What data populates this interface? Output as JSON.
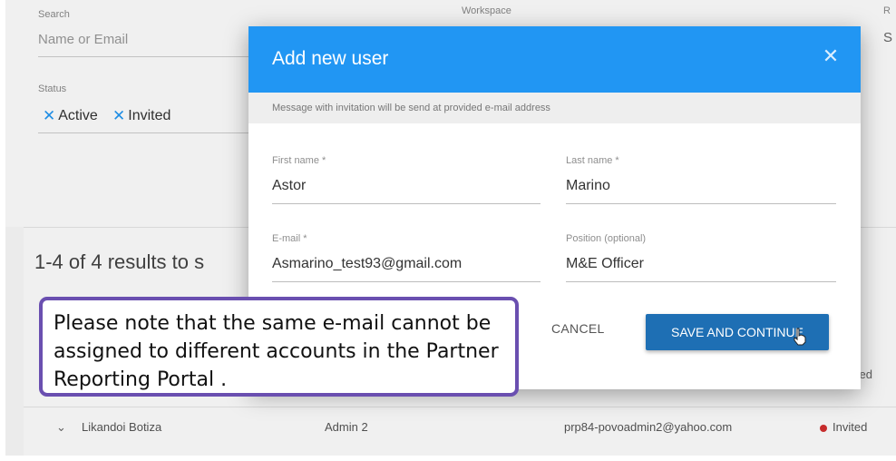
{
  "filters": {
    "search_label": "Search",
    "search_placeholder": "Name or Email",
    "workspace_label": "Workspace",
    "role_label_partial": "R",
    "role_value_partial": "S",
    "status_label": "Status",
    "status_chips": [
      "Active",
      "Invited"
    ]
  },
  "results": {
    "title_partial": "1-4 of 4 results to s"
  },
  "table": {
    "partial_status": "ited",
    "row": {
      "name": "Likandoi Botiza",
      "role": "Admin 2",
      "email": "prp84-povoadmin2@yahoo.com",
      "status": "Invited"
    }
  },
  "modal": {
    "title": "Add new user",
    "info": "Message with invitation will be send at provided e-mail address",
    "fields": {
      "first_name_label": "First name *",
      "first_name_value": "Astor",
      "last_name_label": "Last name *",
      "last_name_value": "Marino",
      "email_label": "E-mail *",
      "email_value": "Asmarino_test93@gmail.com",
      "position_label": "Position (optional)",
      "position_value": "M&E Officer"
    },
    "cancel_label": "CANCEL",
    "save_label": "SAVE AND CONTINUE"
  },
  "callout": {
    "text": "Please note that the same e-mail cannot be assigned to different accounts in the Partner Reporting Portal ."
  },
  "colors": {
    "header_blue": "#2196f3",
    "save_blue": "#1e6fb4",
    "callout_border": "#6a4fb0",
    "status_red": "#d32f2f"
  }
}
